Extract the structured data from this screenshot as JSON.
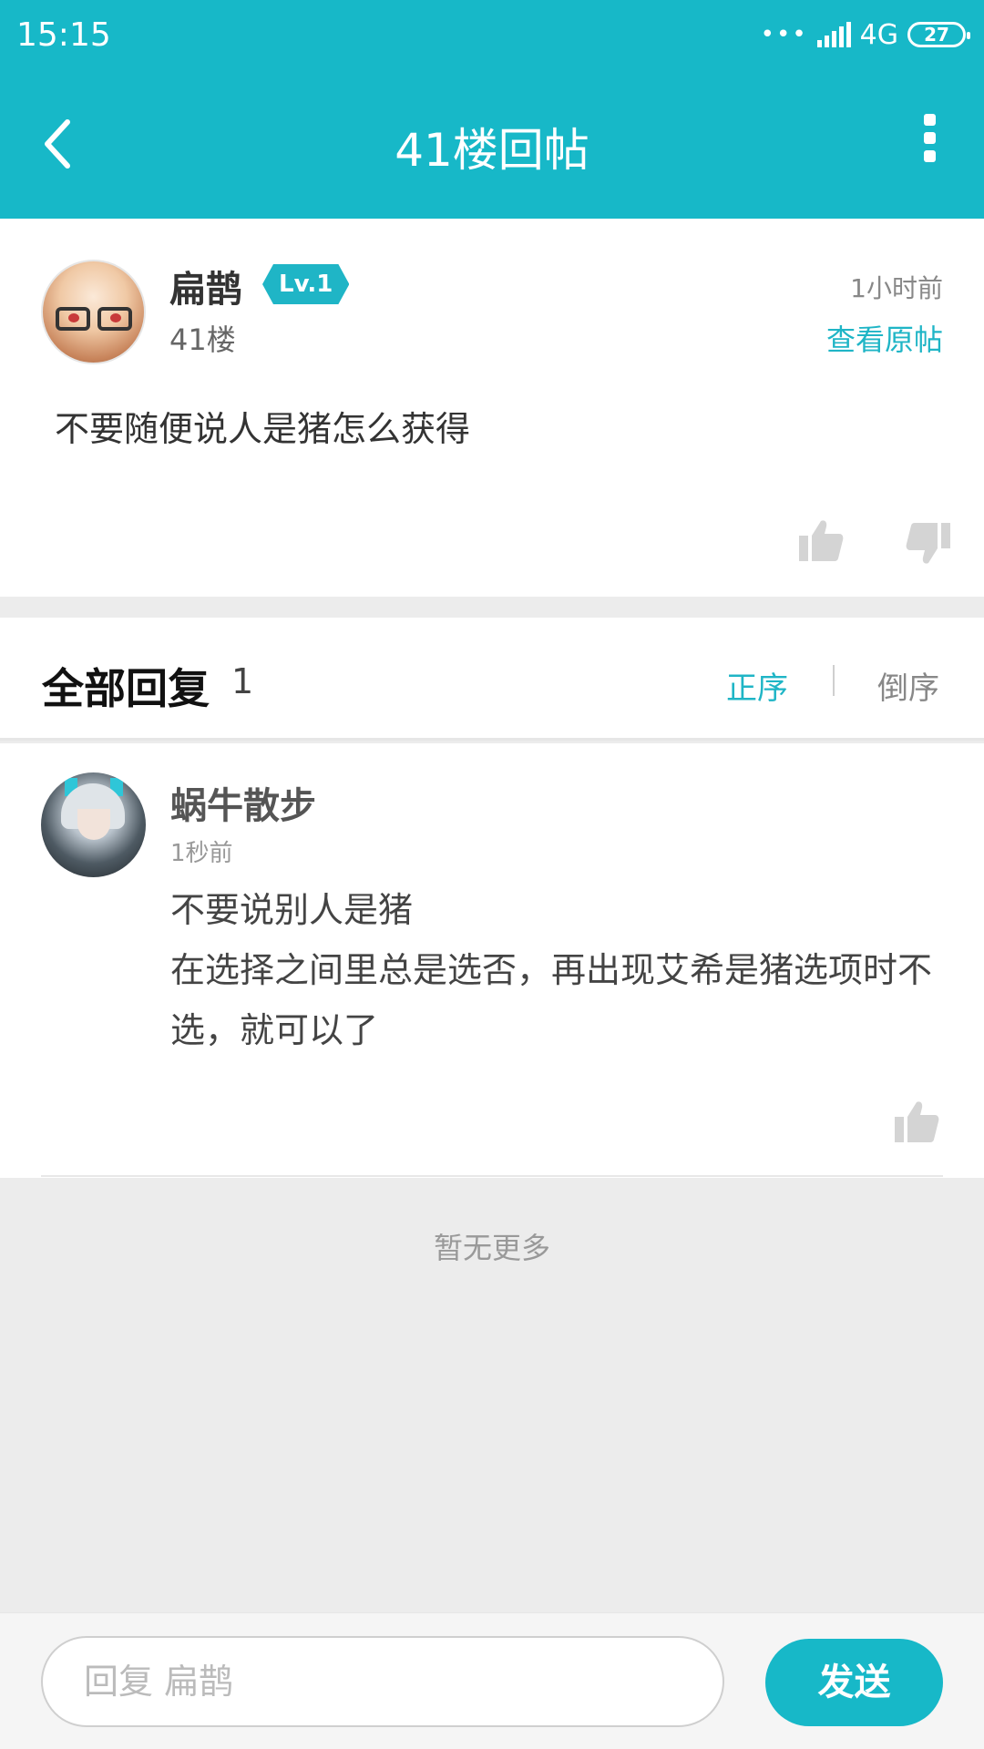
{
  "status_bar": {
    "time": "15:15",
    "dots": "•••",
    "network": "4G",
    "battery": "27"
  },
  "header": {
    "title": "41楼回帖"
  },
  "post": {
    "author": "扁鹊",
    "level_badge": "Lv.1",
    "floor": "41楼",
    "time": "1小时前",
    "view_original_label": "查看原帖",
    "content": "不要随便说人是猪怎么获得"
  },
  "replies_section": {
    "title": "全部回复",
    "count": "1",
    "sort_asc_label": "正序",
    "sort_desc_label": "倒序"
  },
  "replies": [
    {
      "author": "蜗牛散步",
      "time": "1秒前",
      "content": "不要说别人是猪\n在选择之间里总是选否，再出现艾希是猪选项时不选，就可以了"
    }
  ],
  "footer_note": "暂无更多",
  "composer": {
    "placeholder": "回复 扁鹊",
    "send_label": "发送"
  },
  "colors": {
    "accent": "#17b8c8",
    "background": "#ececec"
  }
}
